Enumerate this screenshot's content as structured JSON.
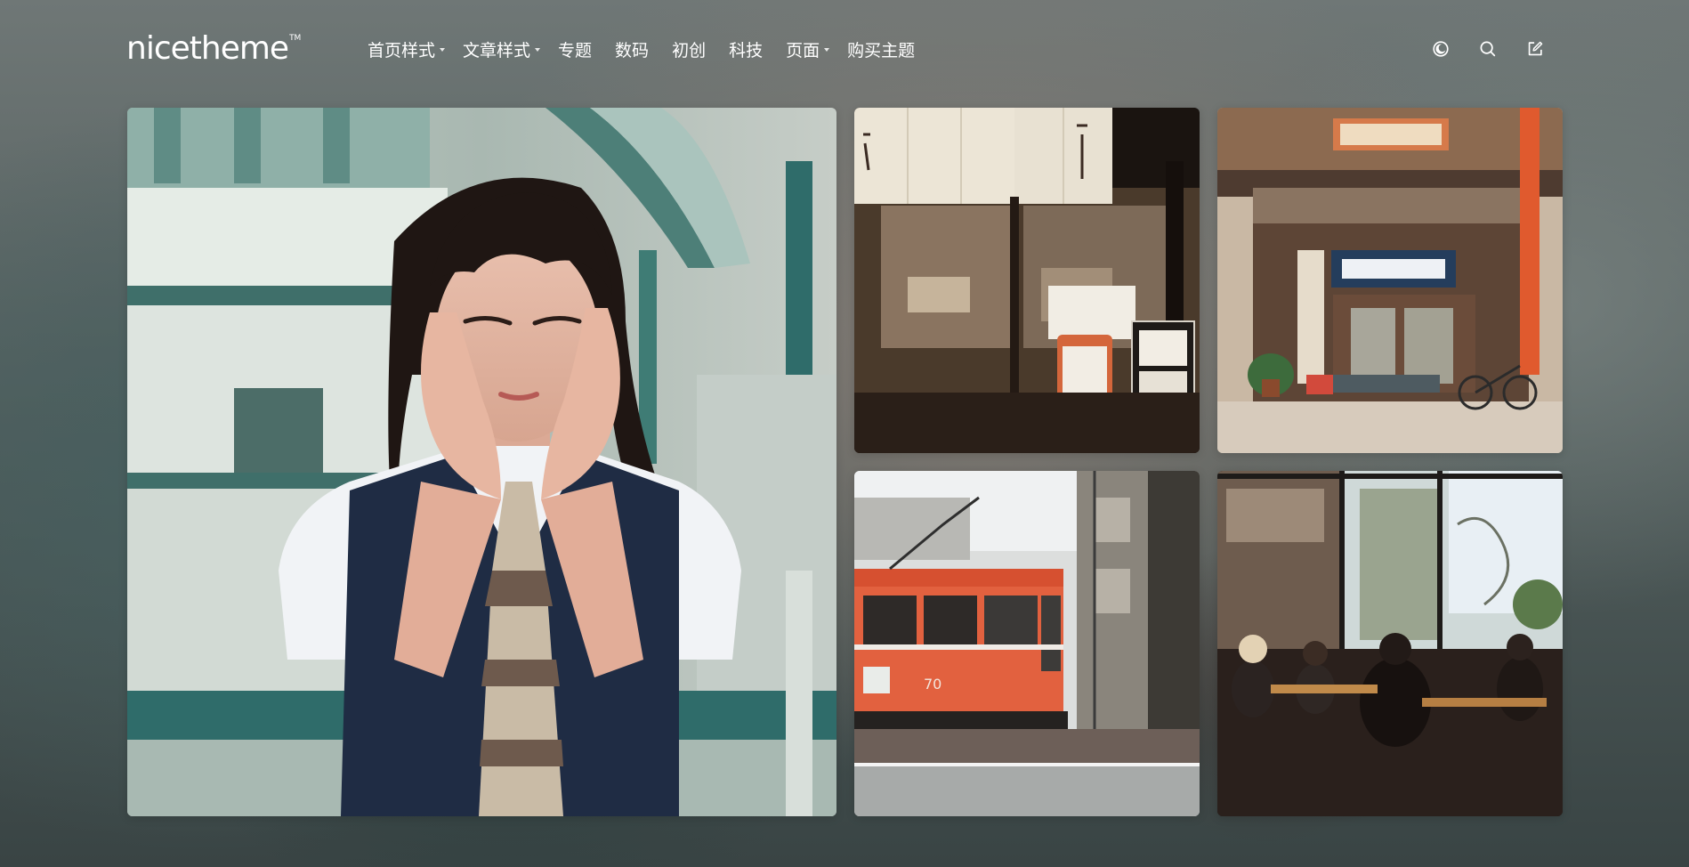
{
  "brand": {
    "logo_text": "nicetheme",
    "logo_mark": "TM"
  },
  "nav": {
    "items": [
      {
        "label": "首页样式",
        "has_menu": true
      },
      {
        "label": "文章样式",
        "has_menu": true
      },
      {
        "label": "专题",
        "has_menu": false
      },
      {
        "label": "数码",
        "has_menu": false
      },
      {
        "label": "初创",
        "has_menu": false
      },
      {
        "label": "科技",
        "has_menu": false
      },
      {
        "label": "页面",
        "has_menu": true
      },
      {
        "label": "购买主题",
        "has_menu": false
      }
    ]
  },
  "tools": {
    "icons": [
      "theme-toggle-icon",
      "search-icon",
      "write-icon"
    ]
  },
  "featured": {
    "cards": [
      {
        "icon": "photo-girl-school-uniform"
      },
      {
        "icon": "photo-restaurant-noren"
      },
      {
        "icon": "photo-shop-facade"
      },
      {
        "icon": "photo-orange-tram"
      },
      {
        "icon": "photo-cafe-interior"
      }
    ]
  },
  "colors": {
    "text": "#ffffff",
    "tram": "#e2613f",
    "accent_green": "#2f6c6a"
  }
}
